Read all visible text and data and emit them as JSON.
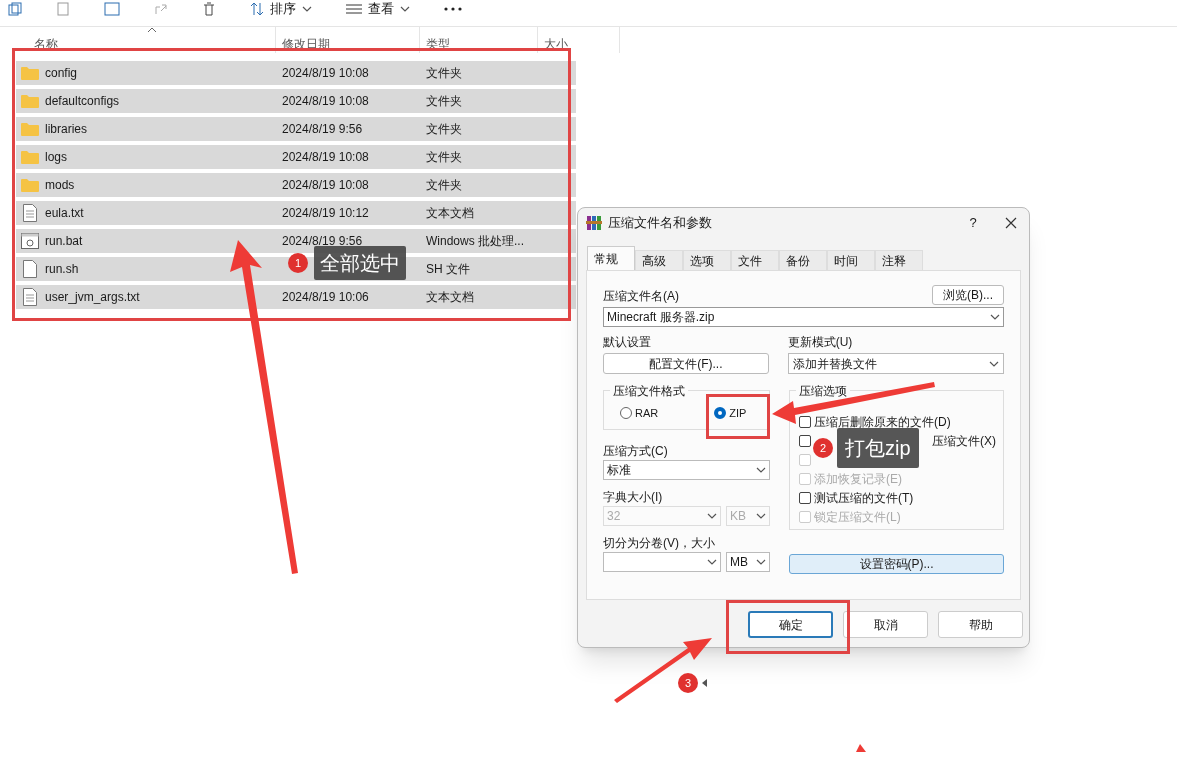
{
  "toolbar": {
    "sort_label": "排序",
    "view_label": "查看"
  },
  "file_list": {
    "columns": [
      "名称",
      "修改日期",
      "类型",
      "大小"
    ],
    "rows": [
      {
        "name": "config",
        "date": "2024/8/19 10:08",
        "type": "文件夹",
        "kind": "folder",
        "selected": true
      },
      {
        "name": "defaultconfigs",
        "date": "2024/8/19 10:08",
        "type": "文件夹",
        "kind": "folder",
        "selected": true
      },
      {
        "name": "libraries",
        "date": "2024/8/19 9:56",
        "type": "文件夹",
        "kind": "folder",
        "selected": true
      },
      {
        "name": "logs",
        "date": "2024/8/19 10:08",
        "type": "文件夹",
        "kind": "folder",
        "selected": true
      },
      {
        "name": "mods",
        "date": "2024/8/19 10:08",
        "type": "文件夹",
        "kind": "folder",
        "selected": true
      },
      {
        "name": "eula.txt",
        "date": "2024/8/19 10:12",
        "type": "文本文档",
        "kind": "text",
        "selected": true
      },
      {
        "name": "run.bat",
        "date": "2024/8/19 9:56",
        "type": "Windows 批处理...",
        "kind": "batch",
        "selected": true
      },
      {
        "name": "run.sh",
        "type": "SH 文件",
        "kind": "file",
        "selected": true
      },
      {
        "name": "user_jvm_args.txt",
        "date": "2024/8/19 10:06",
        "type": "文本文档",
        "kind": "text",
        "selected": true
      }
    ]
  },
  "dialog": {
    "title": "压缩文件名和参数",
    "help": "?",
    "tabs": [
      {
        "label": "常规",
        "selected": true
      },
      {
        "label": "高级",
        "selected": false
      },
      {
        "label": "选项",
        "selected": false
      },
      {
        "label": "文件",
        "selected": false
      },
      {
        "label": "备份",
        "selected": false
      },
      {
        "label": "时间",
        "selected": false
      },
      {
        "label": "注释",
        "selected": false
      }
    ],
    "archive_name_label": "压缩文件名(A)",
    "browse_button": "浏览(B)...",
    "archive_name": "Minecraft 服务器.zip",
    "defaults_label": "默认设置",
    "profiles_button": "配置文件(F)...",
    "update_mode_label": "更新模式(U)",
    "update_mode": "添加并替换文件",
    "format_group": "压缩文件格式",
    "formats": [
      {
        "label": "RAR",
        "selected": false
      },
      {
        "label": "ZIP",
        "selected": true
      }
    ],
    "options_group": "压缩选项",
    "options": [
      {
        "label": "压缩后删除原来的文件(D)",
        "checked": false,
        "disabled": false
      },
      {
        "label_end": "压缩文件(X)",
        "checked": false,
        "disabled": false
      },
      {
        "checked": false,
        "disabled": true
      },
      {
        "label": "添加恢复记录(E)",
        "checked": false,
        "disabled": true
      },
      {
        "label": "测试压缩的文件(T)",
        "checked": false,
        "disabled": false
      },
      {
        "label": "锁定压缩文件(L)",
        "checked": false,
        "disabled": true
      }
    ],
    "method_label": "压缩方式(C)",
    "method": "标准",
    "dict_label": "字典大小(I)",
    "dict_value": "32",
    "dict_unit": "KB",
    "dict_disabled": true,
    "split_label": "切分为分卷(V)，大小",
    "split_unit": "MB",
    "password_button": "设置密码(P)...",
    "buttons": [
      {
        "label": "确定",
        "default": true
      },
      {
        "label": "取消",
        "default": false
      },
      {
        "label": "帮助",
        "default": false
      }
    ]
  },
  "annotations": [
    {
      "number": "1",
      "text": "全部选中"
    },
    {
      "number": "2",
      "text": "打包zip"
    },
    {
      "number": "3"
    }
  ]
}
